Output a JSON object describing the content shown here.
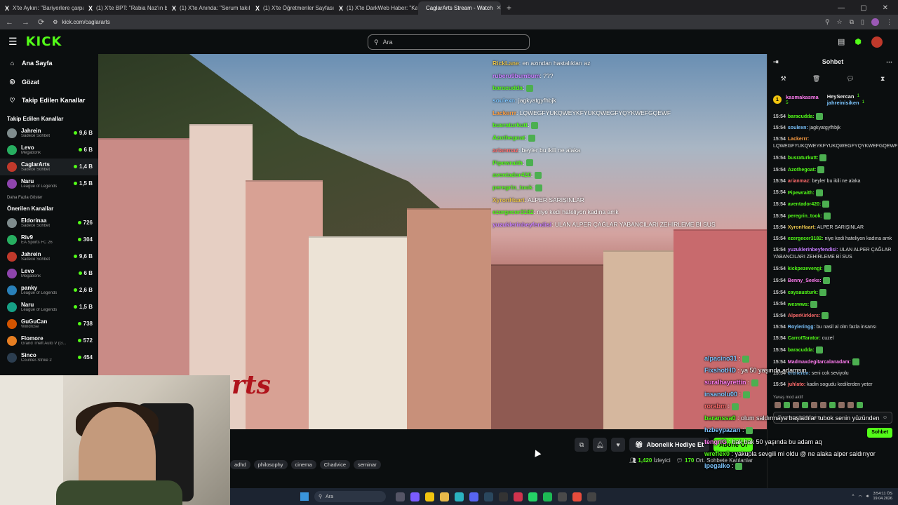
{
  "browser": {
    "tabs": [
      {
        "title": "X'te Aykırı: \"Bariyerlere çarpan",
        "icon": "x-logo"
      },
      {
        "title": "(1) X'te BPT: \"Rabia Naz'ın baba",
        "icon": "x-logo"
      },
      {
        "title": "(1) X'te Anında: \"Serum takılı o",
        "icon": "x-logo"
      },
      {
        "title": "(1) X'te Öğretmenler Sayfası \"İ",
        "icon": "x-logo"
      },
      {
        "title": "(1) X'te DarkWeb Haber: \"Kahra",
        "icon": "x-logo"
      },
      {
        "title": "CaglarArts Stream - Watch",
        "icon": "kick-favicon",
        "active": true
      }
    ],
    "url": "kick.com/caglararts"
  },
  "header": {
    "logo": "KICK",
    "search_placeholder": "Ara"
  },
  "sidebar": {
    "nav": [
      {
        "label": "Ana Sayfa",
        "icon": "home-icon"
      },
      {
        "label": "Gözat",
        "icon": "compass-icon"
      },
      {
        "label": "Takip Edilen Kanallar",
        "icon": "heart-icon"
      }
    ],
    "followed_title": "Takip Edilen Kanallar",
    "followed": [
      {
        "name": "Jahrein",
        "category": "Sadece Sohbet",
        "viewers": "9,6 B"
      },
      {
        "name": "Levo",
        "category": "Megabonk",
        "viewers": "6 B"
      },
      {
        "name": "CaglarArts",
        "category": "Sadece Sohbet",
        "viewers": "1,4 B",
        "active": true
      },
      {
        "name": "Naru",
        "category": "League of Legends",
        "viewers": "1,5 B"
      }
    ],
    "show_more": "Daha Fazla Göster",
    "recommended_title": "Önerilen Kanallar",
    "recommended": [
      {
        "name": "Eldorinaa",
        "category": "Sadece Sohbet",
        "viewers": "726"
      },
      {
        "name": "Riv9",
        "category": "EA Sports FC 26",
        "viewers": "304"
      },
      {
        "name": "Jahrein",
        "category": "Sadece Sohbet",
        "viewers": "9,6 B"
      },
      {
        "name": "Levo",
        "category": "Megabonk",
        "viewers": "6 B"
      },
      {
        "name": "panky",
        "category": "League of Legends",
        "viewers": "2,6 B"
      },
      {
        "name": "Naru",
        "category": "League of Legends",
        "viewers": "1,5 B"
      },
      {
        "name": "GuGuCan",
        "category": "Windrose",
        "viewers": "738"
      },
      {
        "name": "Flomore",
        "category": "Grand Theft Auto V (G...",
        "viewers": "572"
      },
      {
        "name": "Sinco",
        "category": "Counter-Strike 2",
        "viewers": "454"
      }
    ]
  },
  "video_overlay_chat": [
    {
      "user": "RickLane",
      "color": "#e6c14a",
      "text": "en azından hastalıkları az"
    },
    {
      "user": "ruberu9bumbum",
      "color": "#c77dff",
      "text": "???"
    },
    {
      "user": "baracudda",
      "color": "#53fc18",
      "text": ""
    },
    {
      "user": "soulexn",
      "color": "#7cc5ff",
      "text": "jagkyatgyfhbjk"
    },
    {
      "user": "Lackerrr",
      "color": "#ff9f43",
      "text": "LQWEGFYUKQWEYKFYUKQWEGFYQYKWEFGQEWF"
    },
    {
      "user": "busraturkutt",
      "color": "#53fc18",
      "text": ""
    },
    {
      "user": "Azothegoat",
      "color": "#53fc18",
      "text": ""
    },
    {
      "user": "arianmaz",
      "color": "#ff6b6b",
      "text": "beyler bu ikili ne alaka"
    },
    {
      "user": "Pipewraith",
      "color": "#53fc18",
      "text": ""
    },
    {
      "user": "aventador420",
      "color": "#53fc18",
      "text": ""
    },
    {
      "user": "peregrin_took",
      "color": "#53fc18",
      "text": ""
    },
    {
      "user": "XyronHaart",
      "color": "#e6c14a",
      "text": "ALPER SARIŞINLAR"
    },
    {
      "user": "ezergecer3182",
      "color": "#53fc18",
      "text": "niye kedi hateliyon kadına amk"
    },
    {
      "user": "yuzuklerinbeyfendisi",
      "color": "#c77dff",
      "text": "ULAN ALPER ÇAĞLAR YABANCILARI ZEHİRLEME Bİ SUS"
    }
  ],
  "below_player": {
    "tags": [
      "adhd",
      "philosophy",
      "cinema",
      "Chadvice",
      "seminar"
    ],
    "gift_button": "Abonelik Hediye Et",
    "subscribe_button": "Abone Ol",
    "viewers": "1,420",
    "viewers_label": "İzleyici",
    "avg_chatters": "170",
    "avg_chatters_label": "Ort. Sohbete Katılanlar"
  },
  "chat": {
    "title": "Sohbet",
    "pinned": [
      {
        "name": "kasmakasma",
        "count": "5",
        "medal": "1"
      },
      {
        "name": "HeySercan",
        "count": "1"
      },
      {
        "name": "jahreinisiken",
        "count": "1"
      }
    ],
    "messages": [
      {
        "time": "15:54",
        "user": "baracudda:",
        "color": "#53fc18",
        "text": ""
      },
      {
        "time": "15:54",
        "user": "soulexn:",
        "color": "#7cc5ff",
        "text": "jagkyatgyfhbjk"
      },
      {
        "time": "15:54",
        "user": "Lackerrr:",
        "color": "#ff9f43",
        "text": "LQWEGFYUKQWEYKFYUKQWEGFYQYKWEFGQEWF"
      },
      {
        "time": "15:54",
        "user": "busraturkutt:",
        "color": "#53fc18",
        "text": ""
      },
      {
        "time": "15:54",
        "user": "Azothegoat:",
        "color": "#53fc18",
        "text": ""
      },
      {
        "time": "15:54",
        "user": "arianmaz:",
        "color": "#ff6b6b",
        "text": "beyler bu ikili ne alaka"
      },
      {
        "time": "15:54",
        "user": "Pipewraith:",
        "color": "#53fc18",
        "text": ""
      },
      {
        "time": "15:54",
        "user": "aventador420:",
        "color": "#53fc18",
        "text": ""
      },
      {
        "time": "15:54",
        "user": "peregrin_took:",
        "color": "#53fc18",
        "text": ""
      },
      {
        "time": "15:54",
        "user": "XyronHaart:",
        "color": "#e6c14a",
        "text": "ALPER SARIŞINLAR"
      },
      {
        "time": "15:54",
        "user": "ezergecer3182:",
        "color": "#53fc18",
        "text": "niye kedi hateliyon kadına amk"
      },
      {
        "time": "15:54",
        "user": "yuzuklerinbeyfendisi:",
        "color": "#c77dff",
        "text": "ULAN ALPER ÇAĞLAR YABANCILARI ZEHİRLEME Bİ SUS"
      },
      {
        "time": "15:54",
        "user": "kickpezevengi:",
        "color": "#53fc18",
        "text": ""
      },
      {
        "time": "15:54",
        "user": "Benny_Seeks:",
        "color": "#ff7cf0",
        "text": ""
      },
      {
        "time": "15:54",
        "user": "caysausturk:",
        "color": "#53fc18",
        "text": ""
      },
      {
        "time": "15:54",
        "user": "weswws:",
        "color": "#53fc18",
        "text": ""
      },
      {
        "time": "15:54",
        "user": "AlperKirklers:",
        "color": "#ff6b6b",
        "text": ""
      },
      {
        "time": "15:54",
        "user": "Royleringg:",
        "color": "#7cc5ff",
        "text": "bu nasil al olm fazla insansı"
      },
      {
        "time": "15:54",
        "user": "CarrotTarator:",
        "color": "#53fc18",
        "text": "cuzel"
      },
      {
        "time": "15:54",
        "user": "baracudda:",
        "color": "#53fc18",
        "text": ""
      },
      {
        "time": "15:54",
        "user": "Madmaxdegitarcalanadam:",
        "color": "#ff7cf0",
        "text": ""
      },
      {
        "time": "15:54",
        "user": "ereneren:",
        "color": "#7cc5ff",
        "text": "seni cok seviyolu"
      },
      {
        "time": "15:54",
        "user": "juhlato:",
        "color": "#ff6b6b",
        "text": "kadin sogudu kedilerden yeter"
      }
    ],
    "mod_note": "Yavaş mod aktif",
    "input_placeholder": "Bir mesaj gönderin",
    "send_label": "Sohbet"
  },
  "obs_chat": [
    {
      "user": "alpacino31",
      "cls": "",
      "text": ""
    },
    {
      "user": "FixshotHD",
      "cls": "",
      "text": "ya 50 yaşında adamsın"
    },
    {
      "user": "suralhayrettin",
      "cls": "p",
      "text": ""
    },
    {
      "user": "insanolu00",
      "cls": "",
      "text": ""
    },
    {
      "user": "rorabm",
      "cls": "r",
      "text": ""
    },
    {
      "user": "baranssa0",
      "cls": "g",
      "text": "olum saldırmaya başladılar tubok senin yüzünden"
    },
    {
      "user": "hzbeypazarı",
      "cls": "",
      "text": ""
    },
    {
      "user": "tengriG",
      "cls": "p",
      "text": "bak bak 50 yaşında bu adam aq"
    },
    {
      "user": "wreflex0",
      "cls": "g",
      "text": "yakupla sevgili mi oldu @ ne alaka alper saldırıyor"
    },
    {
      "user": "ipegalko",
      "cls": "",
      "text": ""
    }
  ],
  "taskbar": {
    "search": "Ara",
    "time": "3:54:11 ÖS",
    "date": "19.04.2026"
  },
  "video_watermark": "rts"
}
